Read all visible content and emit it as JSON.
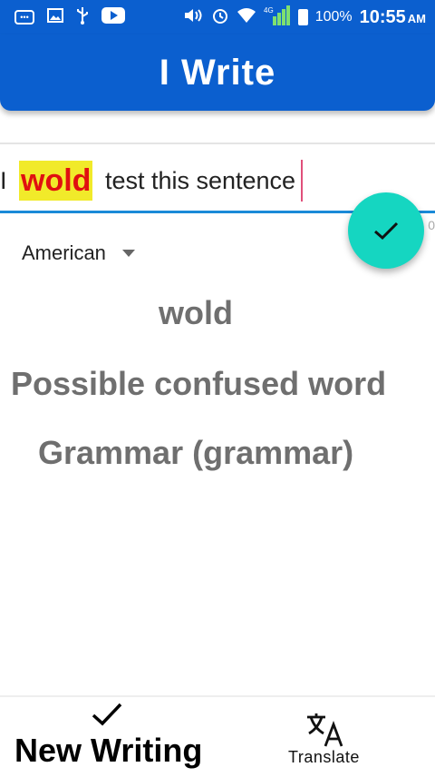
{
  "status_bar": {
    "battery_percent": "100%",
    "time": "10:55",
    "ampm": "AM",
    "signal_label": "4G"
  },
  "app": {
    "title": "I Write"
  },
  "editor": {
    "before": "I ",
    "highlight": "wold",
    "after": " test this sentence"
  },
  "language_dropdown": {
    "selected": "American"
  },
  "suggestion": {
    "word": "wold",
    "message": "Possible confused word",
    "category": "Grammar (grammar)"
  },
  "bottom_nav": {
    "new_writing": "New Writing",
    "translate": "Translate"
  },
  "colors": {
    "primary": "#0b5fcf",
    "fab": "#15d6c1",
    "highlight_bg": "#f1ea2a",
    "highlight_text": "#e01010"
  },
  "icons": [
    "chat-icon",
    "image-icon",
    "usb-icon",
    "youtube-icon",
    "volume-icon",
    "alarm-icon",
    "wifi-icon",
    "signal-icon",
    "battery-icon",
    "check-icon",
    "translate-icon"
  ]
}
